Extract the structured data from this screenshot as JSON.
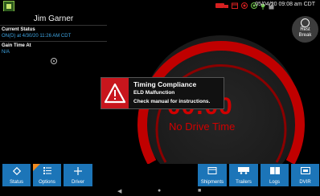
{
  "status_bar": {
    "time": "05/04/20 09:08 am CDT",
    "icons": [
      "truck-icon",
      "calendar-icon",
      "wifi-icon",
      "gps-icon",
      "plug-icon",
      "lock-icon"
    ]
  },
  "driver": {
    "name": "Jim Garner",
    "current_status_label": "Current Status",
    "current_status_value": "ON(D) at 4/30/20 11:26 AM CDT",
    "gain_time_label": "Gain Time At",
    "gain_time_value": "N/A"
  },
  "gauge": {
    "clock": "00:00",
    "subtitle": "No Drive Time",
    "color": "#d00000"
  },
  "rest_break": {
    "line1": "Rest",
    "line2": "Break"
  },
  "alert": {
    "title": "Timing Compliance",
    "line1": "ELD Malfunction",
    "line2": "Check manual for instructions.",
    "color": "#c8161d"
  },
  "toolbar": {
    "status": "Status",
    "options": "Options",
    "driver": "Driver",
    "shipments": "Shipments",
    "trailers": "Trailers",
    "logs": "Logs",
    "dvir": "DVIR",
    "accent": "#1c75b8"
  }
}
